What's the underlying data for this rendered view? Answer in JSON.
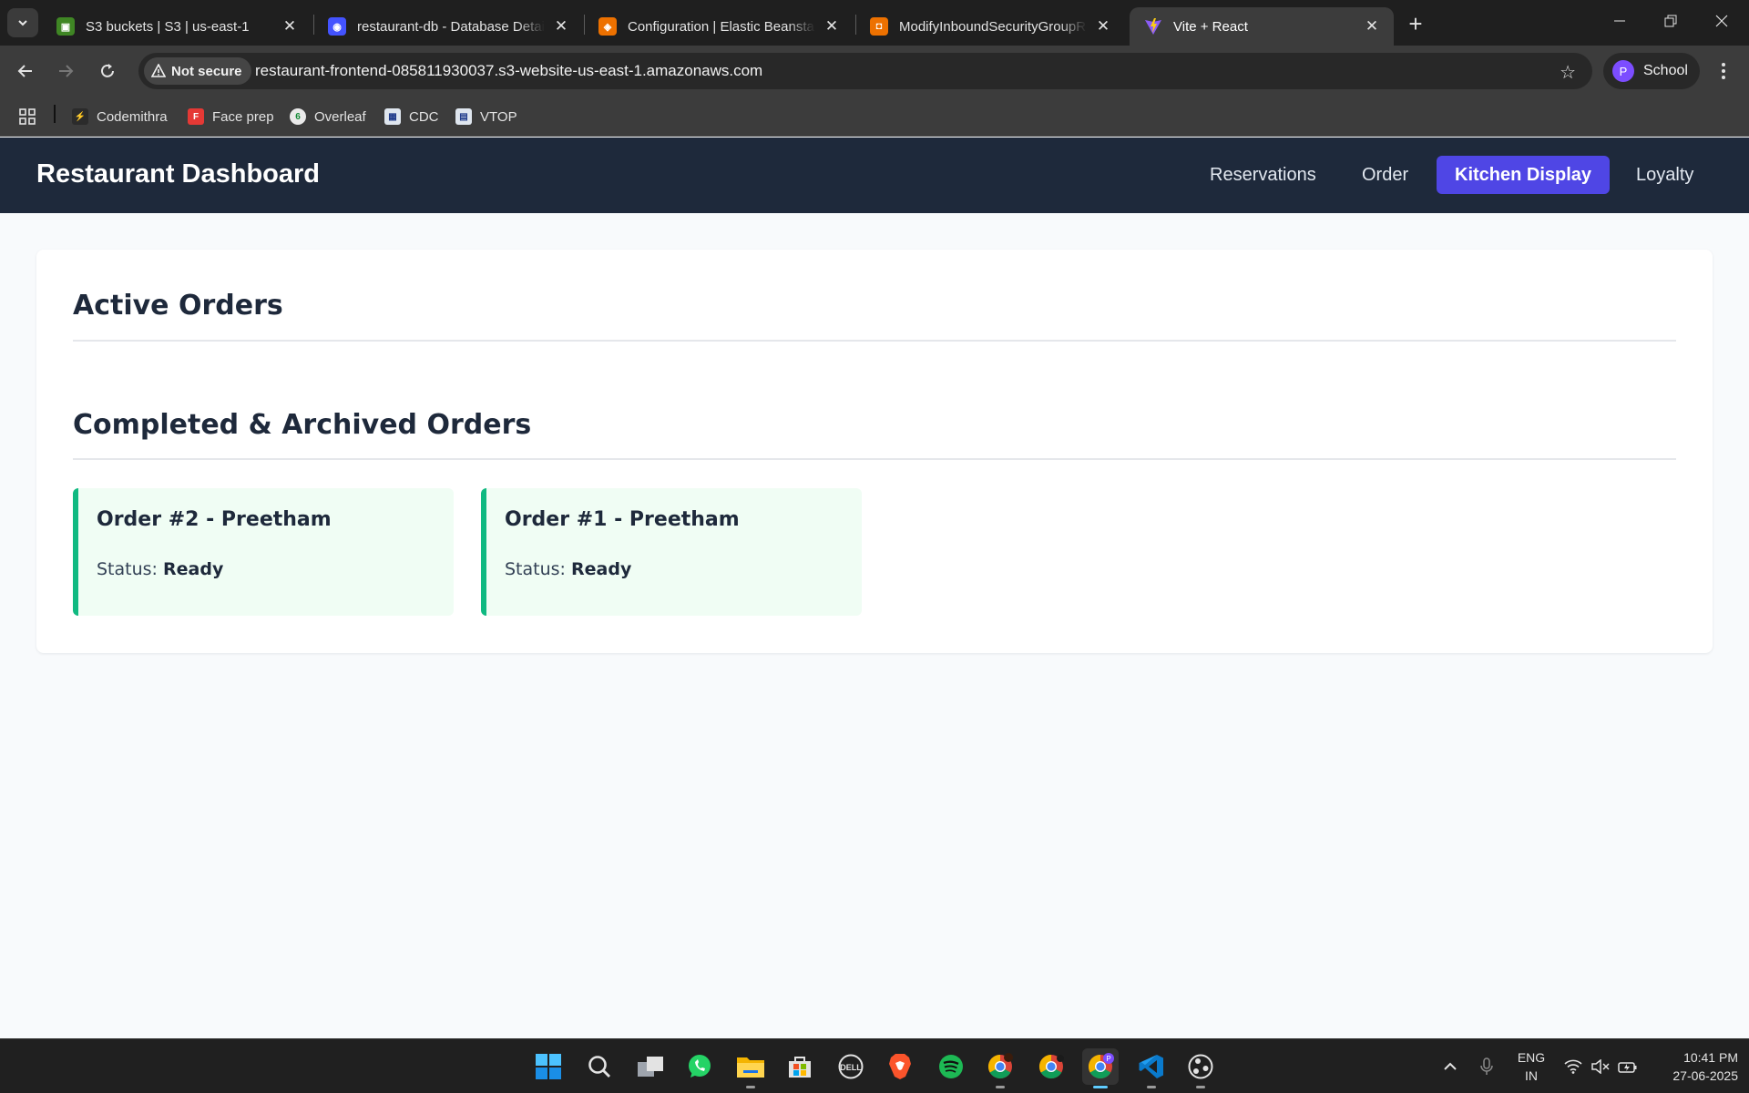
{
  "browser": {
    "tabs": [
      {
        "title": "S3 buckets | S3 | us-east-1",
        "favicon": "s3-icon",
        "color": "#3f8624"
      },
      {
        "title": "restaurant-db - Database Details",
        "favicon": "rds-icon",
        "color": "#4353ff"
      },
      {
        "title": "Configuration | Elastic Beanstalk",
        "favicon": "beanstalk-icon",
        "color": "#ed7100"
      },
      {
        "title": "ModifyInboundSecurityGroupRules",
        "favicon": "ec2-icon",
        "color": "#ed7100"
      },
      {
        "title": "Vite + React",
        "favicon": "vite-icon",
        "color": "#8b5cf6"
      }
    ],
    "security_chip": "Not secure",
    "url": "restaurant-frontend-085811930037.s3-website-us-east-1.amazonaws.com",
    "profile": {
      "initial": "P",
      "name": "School"
    },
    "bookmarks": [
      {
        "label": "Codemithra",
        "icon": "codemithra-icon"
      },
      {
        "label": "Face prep",
        "icon": "faceprep-icon"
      },
      {
        "label": "Overleaf",
        "icon": "overleaf-icon"
      },
      {
        "label": "CDC",
        "icon": "cdc-icon"
      },
      {
        "label": "VTOP",
        "icon": "vtop-icon"
      }
    ]
  },
  "app": {
    "title": "Restaurant Dashboard",
    "nav": [
      {
        "label": "Reservations",
        "active": false
      },
      {
        "label": "Order",
        "active": false
      },
      {
        "label": "Kitchen Display",
        "active": true
      },
      {
        "label": "Loyalty",
        "active": false
      }
    ],
    "active_orders": {
      "title": "Active Orders",
      "items": []
    },
    "completed_orders": {
      "title": "Completed & Archived Orders",
      "items": [
        {
          "title": "Order #2 - Preetham",
          "status_label": "Status:",
          "status": "Ready"
        },
        {
          "title": "Order #1 - Preetham",
          "status_label": "Status:",
          "status": "Ready"
        }
      ]
    },
    "colors": {
      "header": "#1e293b",
      "accent": "#4f46e5",
      "ready": "#10b981",
      "ready_bg": "#f0fdf4"
    }
  },
  "taskbar": {
    "apps": [
      "windows-start-icon",
      "search-icon",
      "task-view-icon",
      "whatsapp-icon",
      "file-explorer-icon",
      "microsoft-store-icon",
      "dell-icon",
      "brave-icon",
      "spotify-icon",
      "chrome-icon",
      "chrome-icon",
      "chrome-profile-icon",
      "vscode-icon",
      "obs-icon"
    ],
    "language": {
      "line1": "ENG",
      "line2": "IN"
    },
    "time": "10:41 PM",
    "date": "27-06-2025"
  }
}
